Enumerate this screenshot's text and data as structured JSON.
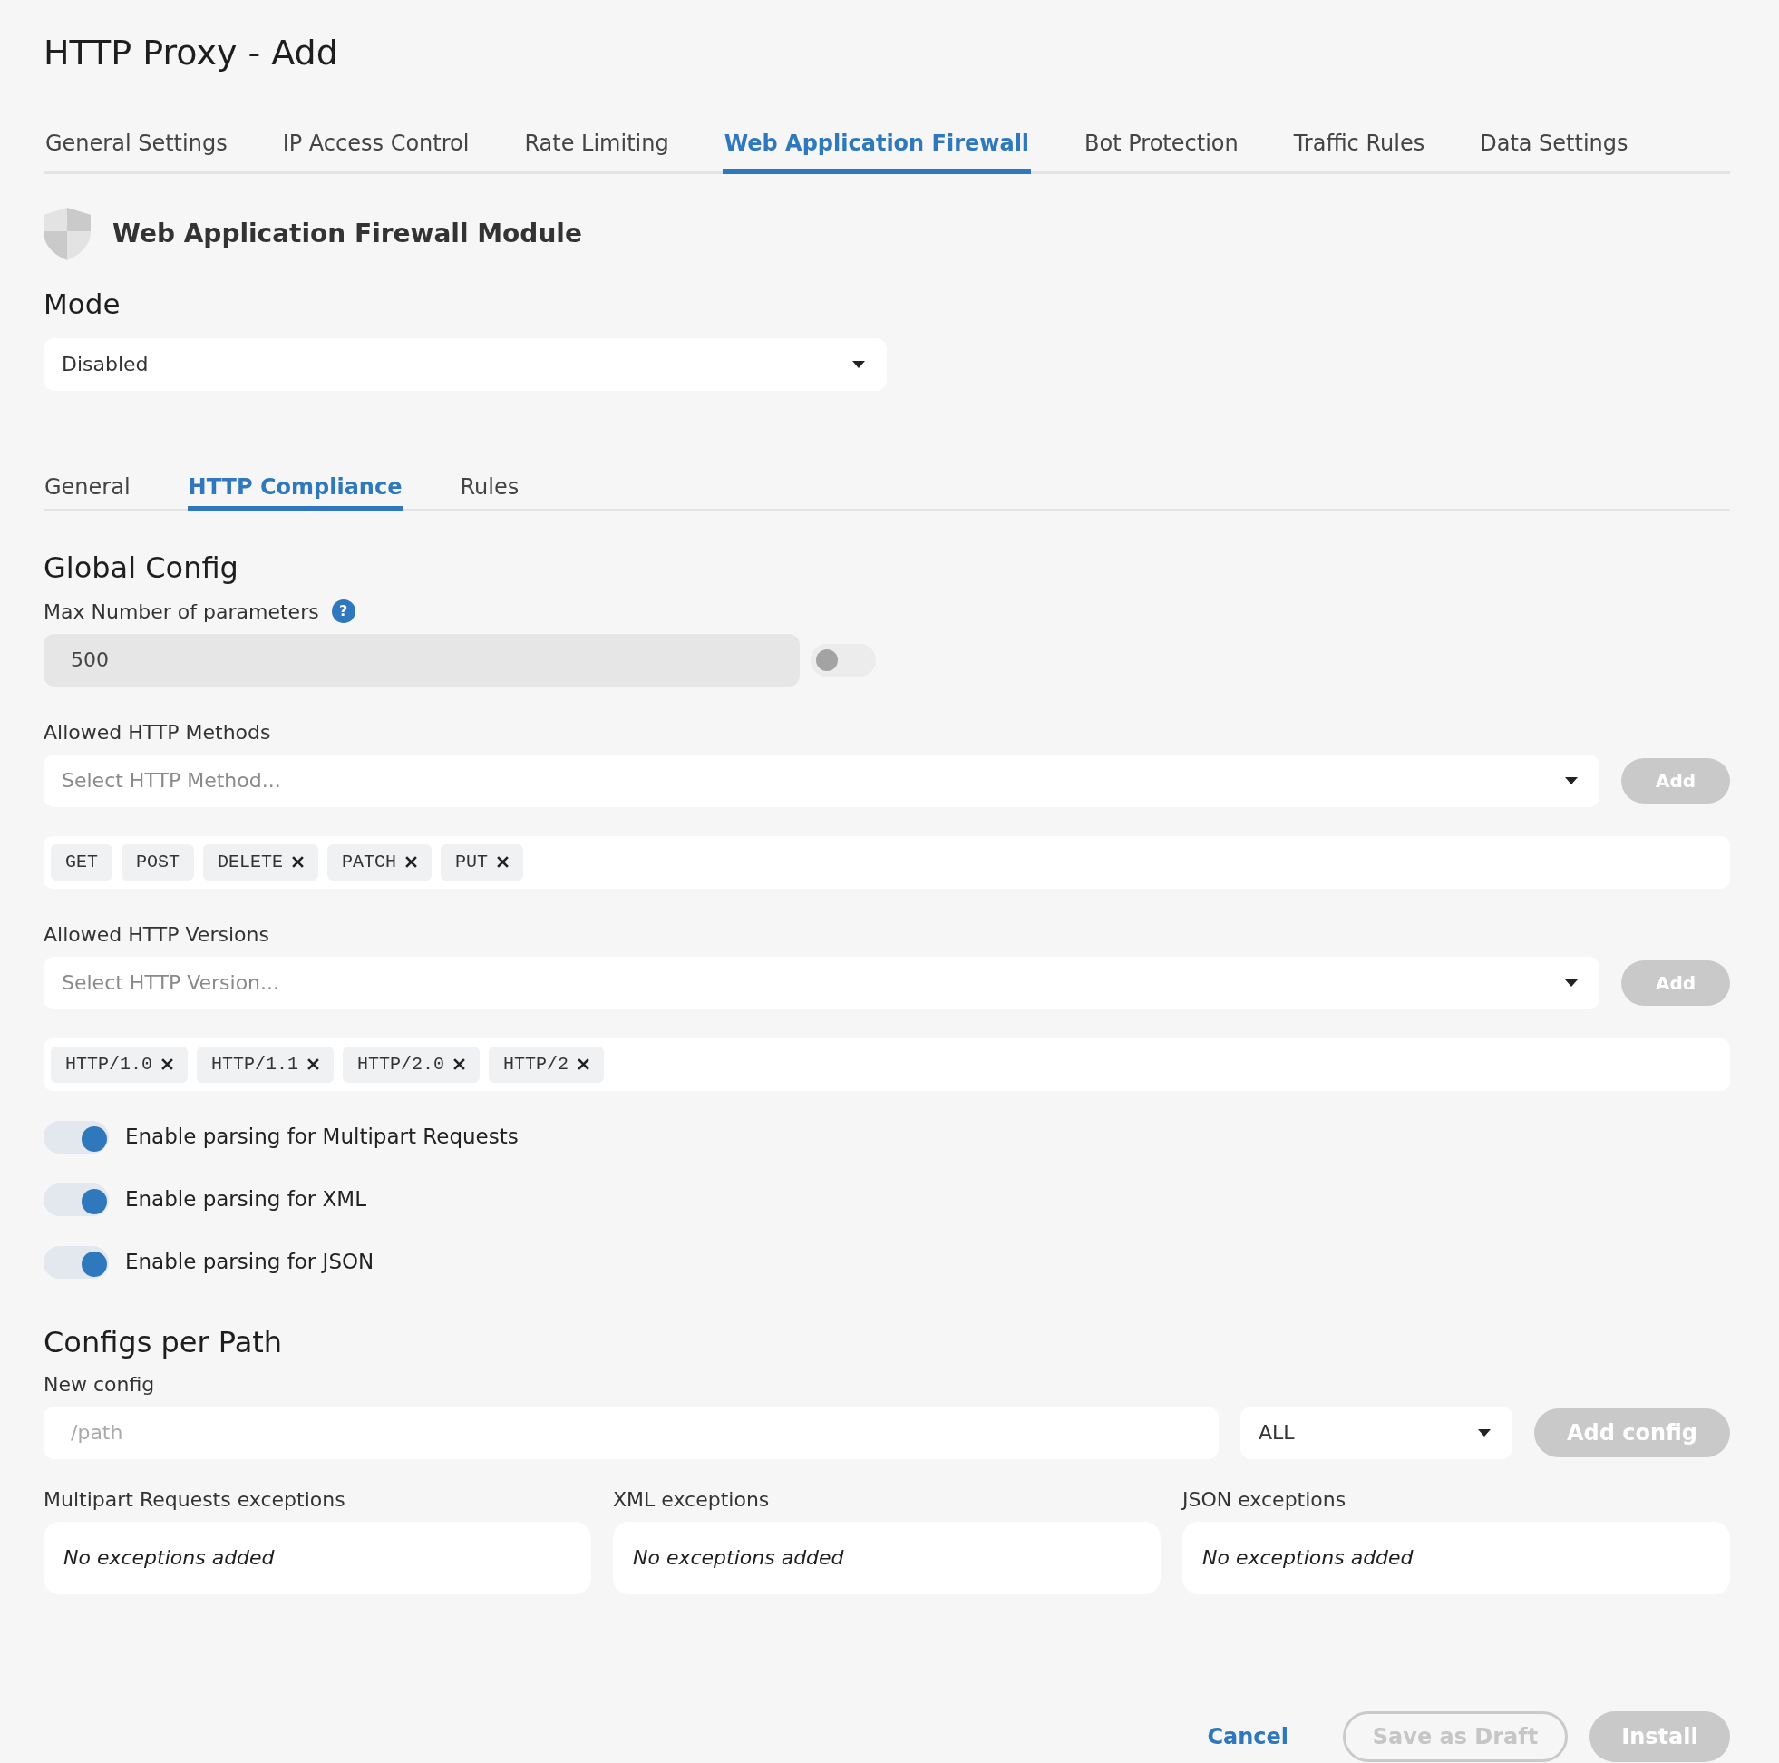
{
  "page_title": "HTTP Proxy - Add",
  "tabs": [
    {
      "label": "General Settings",
      "selected": false
    },
    {
      "label": "IP Access Control",
      "selected": false
    },
    {
      "label": "Rate Limiting",
      "selected": false
    },
    {
      "label": "Web Application Firewall",
      "selected": true
    },
    {
      "label": "Bot Protection",
      "selected": false
    },
    {
      "label": "Traffic Rules",
      "selected": false
    },
    {
      "label": "Data Settings",
      "selected": false
    }
  ],
  "module_title": "Web Application Firewall Module",
  "mode": {
    "label": "Mode",
    "value": "Disabled"
  },
  "subtabs": [
    {
      "label": "General",
      "selected": false
    },
    {
      "label": "HTTP Compliance",
      "selected": true
    },
    {
      "label": "Rules",
      "selected": false
    }
  ],
  "global_config": {
    "title": "Global Config",
    "max_params": {
      "label": "Max Number of parameters",
      "help": "?",
      "value": "500",
      "on": false
    },
    "methods": {
      "label": "Allowed HTTP Methods",
      "placeholder": "Select HTTP Method...",
      "button": "Add",
      "tags": [
        {
          "label": "GET",
          "removable": false
        },
        {
          "label": "POST",
          "removable": false
        },
        {
          "label": "DELETE",
          "removable": true
        },
        {
          "label": "PATCH",
          "removable": true
        },
        {
          "label": "PUT",
          "removable": true
        }
      ]
    },
    "versions": {
      "label": "Allowed HTTP Versions",
      "placeholder": "Select HTTP Version...",
      "button": "Add",
      "tags": [
        {
          "label": "HTTP/1.0",
          "removable": true
        },
        {
          "label": "HTTP/1.1",
          "removable": true
        },
        {
          "label": "HTTP/2.0",
          "removable": true
        },
        {
          "label": "HTTP/2",
          "removable": true
        }
      ]
    },
    "toggles": [
      {
        "label": "Enable parsing for Multipart Requests",
        "on": true
      },
      {
        "label": "Enable parsing for XML",
        "on": true
      },
      {
        "label": "Enable parsing for JSON",
        "on": true
      }
    ]
  },
  "configs_per_path": {
    "title": "Configs per Path",
    "new_config_label": "New config",
    "path_placeholder": "/path",
    "method": "ALL",
    "button": "Add config",
    "exceptions": [
      {
        "label": "Multipart Requests exceptions",
        "empty": "No exceptions added"
      },
      {
        "label": "XML exceptions",
        "empty": "No exceptions added"
      },
      {
        "label": "JSON exceptions",
        "empty": "No exceptions added"
      }
    ]
  },
  "footer": {
    "cancel": "Cancel",
    "draft": "Save as Draft",
    "install": "Install"
  }
}
